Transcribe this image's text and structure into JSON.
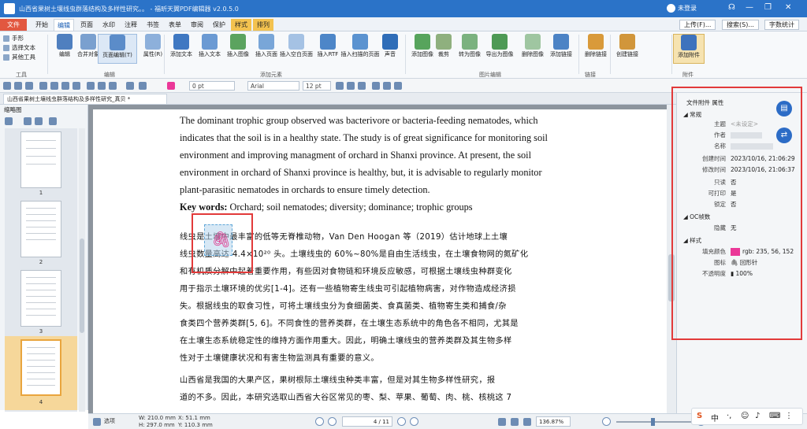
{
  "window": {
    "title": "山西省果树土壤线虫群落结构及多样性研究。。 - 福昕天翼PDF编辑器 v2.0.5.0",
    "user": "未登录"
  },
  "menu": {
    "tabs": [
      "文件",
      "开始",
      "编辑",
      "页面",
      "水印",
      "注释",
      "书签",
      "表单",
      "审阅",
      "保护",
      "样式",
      "排列"
    ],
    "active": "编辑",
    "right_buttons": [
      "上传(F)...",
      "搜索(S)...",
      "字数统计"
    ]
  },
  "ribbon": {
    "left_tools": [
      "手形",
      "选择文本",
      "其他工具"
    ],
    "left_group": "工具",
    "buttons": [
      "编辑",
      "合并对象",
      "页面编辑(T)",
      "属性(R)",
      "添加文本",
      "插入文本",
      "插入图像",
      "插入页面",
      "插入空白页面",
      "插入RTF",
      "插入扫描的页面",
      "声音",
      "添加图像",
      "裁剪",
      "转为图像",
      "导出为图像",
      "删除图像",
      "添加链接",
      "删除链接",
      "创建链接",
      "添加附件"
    ],
    "groups": [
      "编辑",
      "添加元素",
      "图片编辑",
      "链接",
      "附件"
    ]
  },
  "format": {
    "size": "0 pt",
    "font": "Arial",
    "font_size": "12 pt"
  },
  "doc_tab": "山西省果树土壤线虫群落结构及多样性研究_真贝 *",
  "left_panel": {
    "title": "缩略图",
    "pages": [
      "1",
      "2",
      "3",
      "4"
    ]
  },
  "document": {
    "en_lines": [
      "The dominant trophic group observed was bacterivore or bacteria-feeding nematodes, which",
      "indicates that the soil is in a healthy state. The study is of great significance for monitoring soil",
      "environment and improving managment of orchard in Shanxi province. At present, the soil",
      "environment in orchard of Shanxi province is healthy, but, it is advisable to regularly monitor",
      "plant-parasitic nematodes in orchards to ensure timely detection."
    ],
    "keywords_label": "Key words:",
    "keywords": " Orchard; soil nematodes; diversity; dominance; trophic groups",
    "cn_lines": [
      "线虫是土壤中最丰富的低等无脊椎动物，Van Den Hoogan 等（2019）估计地球上土壤",
      "线虫数量高达 4.4×10²⁰ 头。土壤线虫的 60%~80%是自由生活线虫，在土壤食物网的氮矿化",
      "和有机质分解中起着重要作用，有些因对食物链和环境反应敏感，可根据土壤线虫种群变化",
      "用于指示土壤环境的优劣[1-4]。还有一些植物寄生线虫可引起植物病害，对作物造成经济损",
      "失。根据线虫的取食习性，可将土壤线虫分为食细菌类、食真菌类、植物寄生类和捕食/杂",
      "食类四个营养类群[5, 6]。不同食性的营养类群，在土壤生态系统中的角色各不相同，尤其是",
      "在土壤生态系统稳定性的维持方面作用重大。因此，明确土壤线虫的营养类群及其生物多样",
      "性对于土壤健康状况和有害生物监测具有重要的意义。",
      "    山西省是我国的大果产区，果树根际土壤线虫种类丰富，但是对其生物多样性研究，报",
      "道的不多。因此，本研究选取山西省大谷区常见的枣、梨、苹果、葡萄、肉、桃、核桃这 7"
    ]
  },
  "properties": {
    "title": "文件附件 属性",
    "sections": {
      "general": "常规",
      "oc": "OC帧数",
      "style": "样式"
    },
    "general": [
      {
        "k": "主题",
        "v": "<未设定>"
      },
      {
        "k": "作者",
        "v": ""
      },
      {
        "k": "名称",
        "v": ""
      },
      {
        "k": "创建时间",
        "v": "2023/10/16, 21:06:29"
      },
      {
        "k": "修改时间",
        "v": "2023/10/16, 21:06:37"
      },
      {
        "k": "只读",
        "v": "否"
      },
      {
        "k": "可打印",
        "v": "是"
      },
      {
        "k": "锁定",
        "v": "否"
      }
    ],
    "oc": [
      {
        "k": "隐藏",
        "v": "无"
      }
    ],
    "style": [
      {
        "k": "填充颜色",
        "v": "rgb: 235, 56, 152"
      },
      {
        "k": "图标",
        "v": "回形针"
      },
      {
        "k": "不透明度",
        "v": "100%"
      }
    ],
    "fill_color": "#eb3898"
  },
  "status": {
    "mode": "选项",
    "w": "W: 210.0 mm",
    "h": "H: 297.0 mm",
    "x": "X: 51.1 mm",
    "y": "Y: 110.3 mm",
    "page": "4 / 11",
    "zoom": "136.87%"
  }
}
